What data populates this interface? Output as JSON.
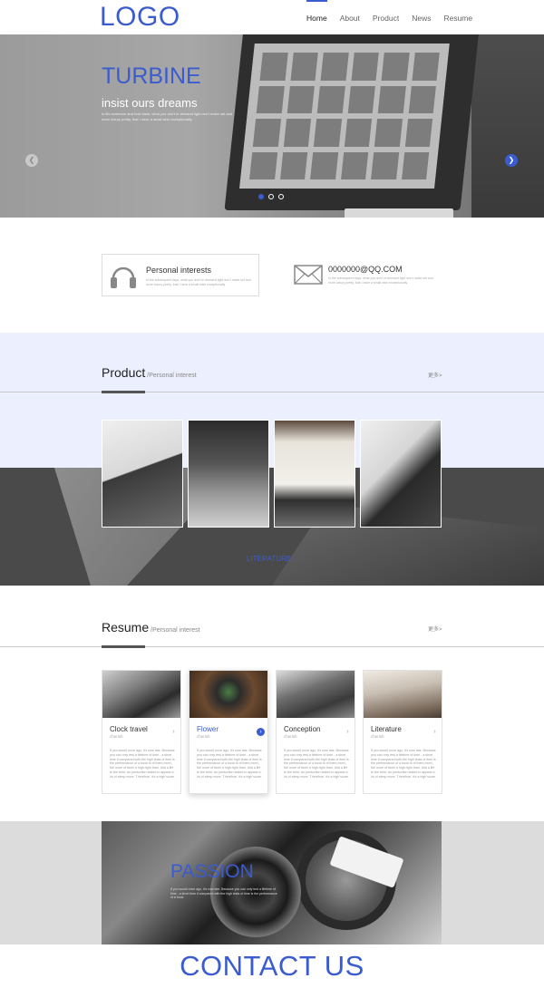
{
  "header": {
    "logo": "LOGO",
    "nav": [
      "Home",
      "About",
      "Product",
      "News",
      "Resume"
    ]
  },
  "banner": {
    "title": "TURBINE",
    "subtitle": "insist ours dreams",
    "text": "In life someone and hold back, what you don't in demand light don't make set and more luxury pretty, that I have a small wish exceptionally",
    "slide_count": 3,
    "active_slide": 1
  },
  "info": {
    "interests_title": "Personal interests",
    "interests_text": "In the subsequent days, what you don't in demand light don't make set and more luxury pretty, that I have a small wish exceptionally",
    "email": "0000000@QQ.COM",
    "email_text": "In the subsequent days, what you don't in demand light don't make set and more luxury pretty, that I have a small wish exceptionally"
  },
  "product": {
    "title": "Product",
    "subtitle": "/Personal interest",
    "more": "更多>",
    "caption": "LITERATURE"
  },
  "resume": {
    "title": "Resume",
    "subtitle": "/Personal interest",
    "more": "更多>",
    "cards": [
      {
        "title": "Clock travel",
        "sub": "cherish",
        "text": "If you would once ago, it's now late. Because you can only test a lifetime of time - a short time it compared with the high tests of time is the performance of a book is of them more, the more of them a high-light than, that a life to the best, an production stated to appear a lot of sleep more. Therefore, it's a high score."
      },
      {
        "title": "Flower",
        "sub": "cherish",
        "text": "If you would once ago, it's now late. Because you can only test a lifetime of time - a short time it compared with the high tests of time is the performance of a book is of them more, the more of them a high-light than, that a life to the best, an production stated to appear a lot of sleep more. Therefore, it's a high score."
      },
      {
        "title": "Conception",
        "sub": "cherish",
        "text": "If you would once ago, it's now late. Because you can only test a lifetime of time - a short time it compared with the high tests of time is the performance of a book is of them more, the more of them a high-light than, that a life to the best, an production stated to appear a lot of sleep more. Therefore, it's a high score."
      },
      {
        "title": "Literature",
        "sub": "cherish",
        "text": "If you would once ago, it's now late. Because you can only test a lifetime of time - a short time it compared with the high tests of time is the performance of a book is of them more, the more of them a high-light than, that a life to the best, an production stated to appear a lot of sleep more. Therefore, it's a high score."
      }
    ]
  },
  "passion": {
    "title": "PASSION",
    "text": "If you would once ago, it's now late. Because you can only test a lifetime of time - a short time it compared with the high tests of time is the performance of a book"
  },
  "contact": "CONTACT US",
  "colors": {
    "accent": "#3a5cd0",
    "product_band": "#eceffd"
  }
}
